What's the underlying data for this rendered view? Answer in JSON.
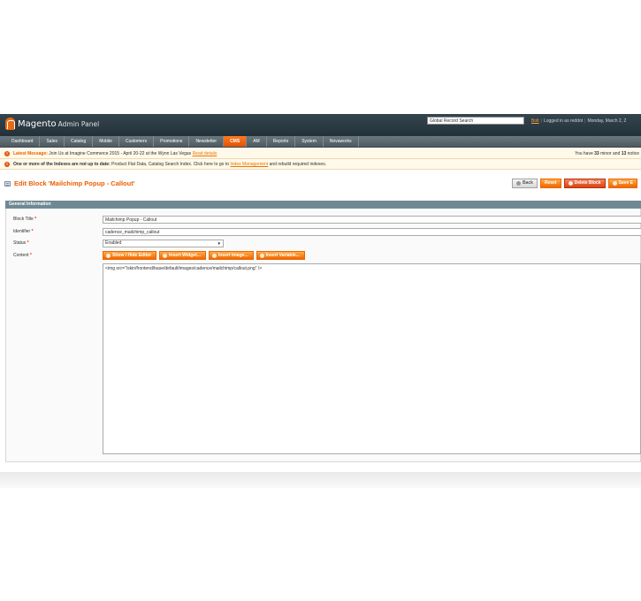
{
  "header": {
    "logo_brand": "Magento",
    "logo_sub": "Admin Panel",
    "global_search_value": "Global Record Search",
    "user_link": "Bolt",
    "logged_in": "Logged in as reddot",
    "date": "Monday, March 2, 2"
  },
  "nav": [
    "Dashboard",
    "Sales",
    "Catalog",
    "Mobile",
    "Customers",
    "Promotions",
    "Newsletter",
    "CMS",
    "AM",
    "Reports",
    "System",
    "Novaworks"
  ],
  "nav_active": "CMS",
  "messages": {
    "latest_label": "Latest Message:",
    "latest_text": "Join Us at Imagine Commerce 2015 - April 20-22 at the Wynn Las Vegas",
    "latest_link": "Read details",
    "notice_pre": "You have ",
    "notice_minor": "33",
    "notice_mid": " minor and ",
    "notice_count": "13",
    "notice_post": " notice",
    "index_label": "One or more of the Indexes are not up to date:",
    "index_text": "Product Flat Data, Catalog Search Index. Click here to go to",
    "index_link": "Index Management",
    "index_tail": "and rebuild required indexes."
  },
  "page": {
    "title": "Edit Block 'Mailchimp Popup - Callout'",
    "buttons": {
      "back": "Back",
      "reset": "Reset",
      "delete": "Delete Block",
      "save": "Save E"
    }
  },
  "form": {
    "section_title": "General Information",
    "block_title_label": "Block Title",
    "block_title_value": "Mailchimp Popup - Callout",
    "identifier_label": "Identifier",
    "identifier_value": "cadence_mailchimp_callout",
    "status_label": "Status",
    "status_value": "Enabled",
    "content_label": "Content",
    "required_mark": "*",
    "editor_buttons": {
      "show_hide": "Show / Hide Editor",
      "widget": "Insert Widget...",
      "image": "Insert Image...",
      "variable": "Insert Variable..."
    },
    "content_value": "<img src=\"/skin/frontend/base/default/images/cadence/mailchimp/callout.png\" />"
  },
  "colors": {
    "header_bg": "#2c3a41",
    "accent": "#eb5e00",
    "nav_active": "#f06700"
  }
}
